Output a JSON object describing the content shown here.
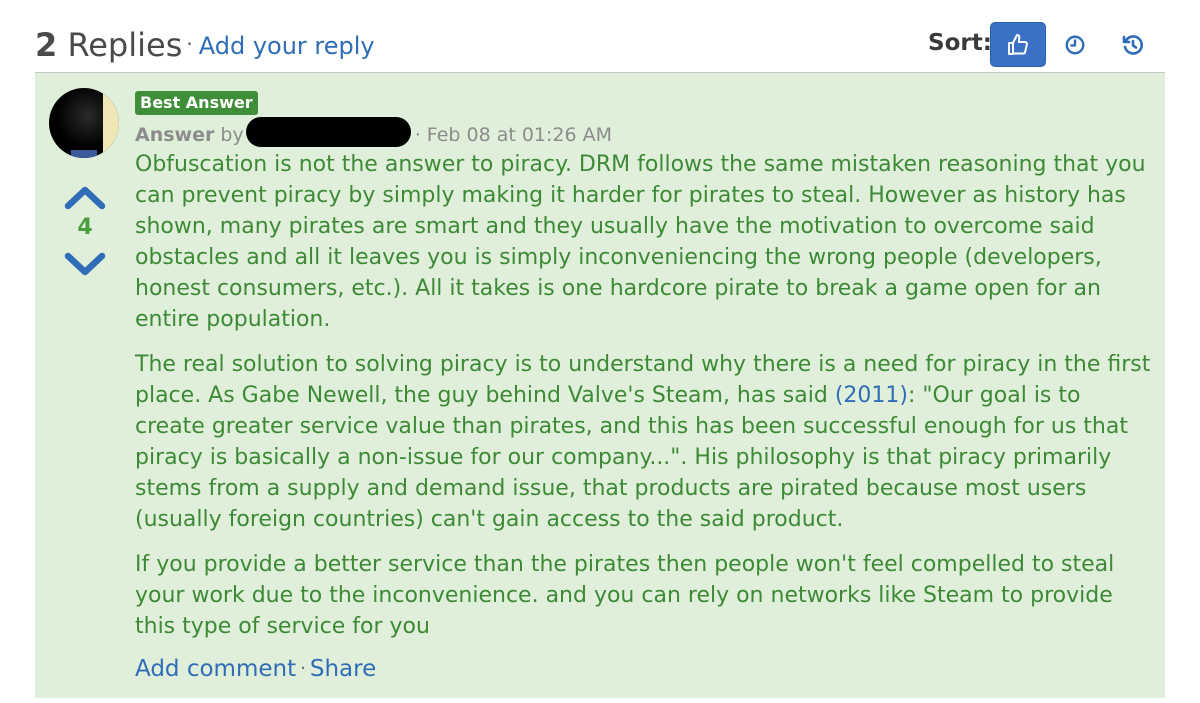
{
  "header": {
    "replies_count": "2",
    "replies_label": "Replies",
    "separator": "·",
    "add_reply": "Add your reply",
    "sort_label": "Sort:",
    "sort_options": [
      {
        "name": "votes",
        "icon": "thumbs-up-icon",
        "active": true
      },
      {
        "name": "recent",
        "icon": "clock-icon",
        "active": false
      },
      {
        "name": "oldest",
        "icon": "history-icon",
        "active": false
      }
    ]
  },
  "answer": {
    "badge": "Best Answer",
    "type_label": "Answer",
    "by_label": "by",
    "date": "· Feb 08 at 01:26 AM",
    "votes": "4",
    "paragraphs": [
      {
        "text": "Obfuscation is not the answer to piracy. DRM follows the same mistaken reasoning that you can prevent piracy by simply making it harder for pirates to steal. However as history has shown, many pirates are smart and they usually have the motivation to overcome said obstacles and all it leaves you is simply inconveniencing the wrong people (developers, honest consumers, etc.). All it takes is one hardcore pirate to break a game open for an entire population."
      },
      {
        "text_before": "The real solution to solving piracy is to understand why there is a need for piracy in the first place. As Gabe Newell, the guy behind Valve's Steam, has said ",
        "link": "(2011)",
        "text_after": ": \"Our goal is to create greater service value than pirates, and this has been successful enough for us that piracy is basically a non-issue for our company...\". His philosophy is that piracy primarily stems from a supply and demand issue, that products are pirated because most users (usually foreign countries) can't gain access to the said product."
      },
      {
        "text": "If you provide a better service than the pirates then people won't feel compelled to steal your work due to the inconvenience. and you can rely on networks like Steam to provide this type of service for you"
      }
    ],
    "actions": {
      "add_comment": "Add comment",
      "separator": "·",
      "share": "Share"
    }
  },
  "colors": {
    "accent": "#3a73c6",
    "answer_bg": "#e0efda",
    "answer_text": "#3c8a35",
    "badge_bg": "#3f8f3a",
    "link": "#2f6db8"
  }
}
